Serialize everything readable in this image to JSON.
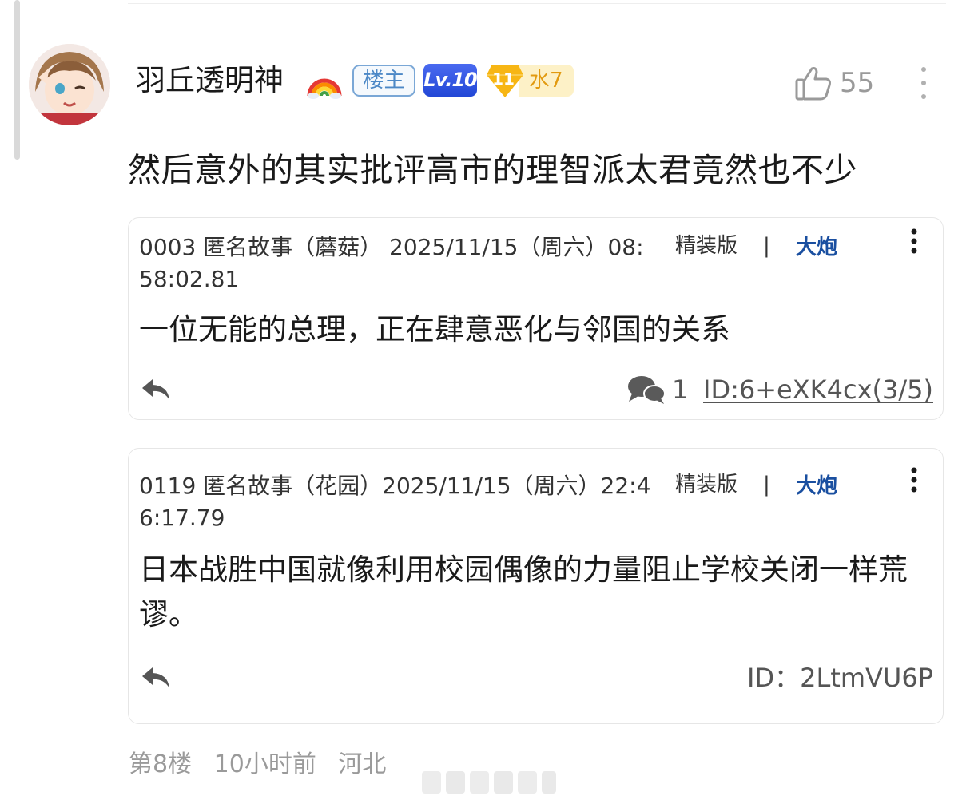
{
  "post": {
    "username": "羽丘透明神",
    "badges": {
      "host": "楼主",
      "level": "Lv.10",
      "water_level": "11",
      "water": "水7"
    },
    "like_count": "55",
    "text": "然后意外的其实批评高市的理智派太君竟然也不少"
  },
  "quotes": [
    {
      "meta_line1": "0003 匿名故事（蘑菇） 2025/11/15（周六）08:",
      "meta_line2": "58:02.81",
      "tag": "精装版",
      "separator": "|",
      "cannon": "大炮",
      "body": "一位无能的总理，正在肆意恶化与邻国的关系",
      "reply_count": "1",
      "id": "ID:6+eXK4cx(3/5)"
    },
    {
      "meta_line1": "0119 匿名故事（花园）2025/11/15（周六）22:4",
      "meta_line2": "6:17.79",
      "tag": "精装版",
      "separator": "|",
      "cannon": "大炮",
      "body": "日本战胜中国就像利用校园偶像的力量阻止学校关闭一样荒谬。",
      "id": "ID：2LtmVU6P"
    }
  ],
  "footer": {
    "floor": "第8楼",
    "time": "10小时前",
    "location": "河北"
  },
  "colors": {
    "host_badge": "#4d88c6",
    "level_badge": "#2247d6",
    "water_badge": "#e29a10",
    "cannon": "#1a4fa0",
    "muted": "#9a9a9a"
  },
  "icons": [
    "thumbs-up-icon",
    "more-vertical-icon",
    "reply-icon",
    "chat-bubbles-icon",
    "rainbow-emoji",
    "diamond-icon"
  ]
}
